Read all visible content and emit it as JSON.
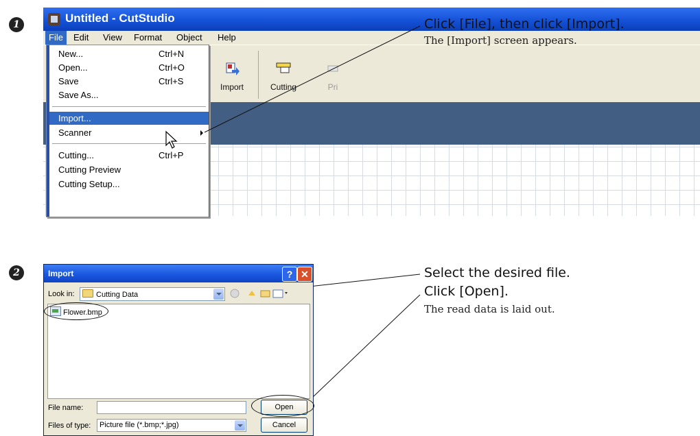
{
  "step1": {
    "number": "1",
    "window": {
      "title": "Untitled - CutStudio",
      "menubar": [
        "File",
        "Edit",
        "View",
        "Format",
        "Object",
        "Help"
      ],
      "toolbar": [
        "Import",
        "Cutting",
        "Pri"
      ]
    },
    "file_menu": [
      {
        "label": "New...",
        "shortcut": "Ctrl+N"
      },
      {
        "label": "Open...",
        "shortcut": "Ctrl+O"
      },
      {
        "label": "Save",
        "shortcut": "Ctrl+S"
      },
      {
        "label": "Save As...",
        "shortcut": ""
      },
      {
        "label": "Import...",
        "shortcut": ""
      },
      {
        "label": "Scanner",
        "shortcut": ""
      },
      {
        "label": "Cutting...",
        "shortcut": "Ctrl+P"
      },
      {
        "label": "Cutting Preview",
        "shortcut": ""
      },
      {
        "label": "Cutting Setup...",
        "shortcut": ""
      }
    ],
    "instruction": "Click [File], then click [Import].",
    "result": "The [Import] screen appears."
  },
  "step2": {
    "number": "2",
    "dialog": {
      "title": "Import",
      "help": "?",
      "close": "✕",
      "look_in_label": "Look in:",
      "look_in_value": "Cutting Data",
      "file_item": "Flower.bmp",
      "file_name_label": "File name:",
      "file_name_value": "",
      "files_of_type_label": "Files of type:",
      "files_of_type_value": "Picture file (*.bmp;*.jpg)",
      "open": "Open",
      "cancel": "Cancel"
    },
    "instruction_line1": "Select the desired file.",
    "instruction_line2": "Click [Open].",
    "result": "The read data is laid out."
  }
}
